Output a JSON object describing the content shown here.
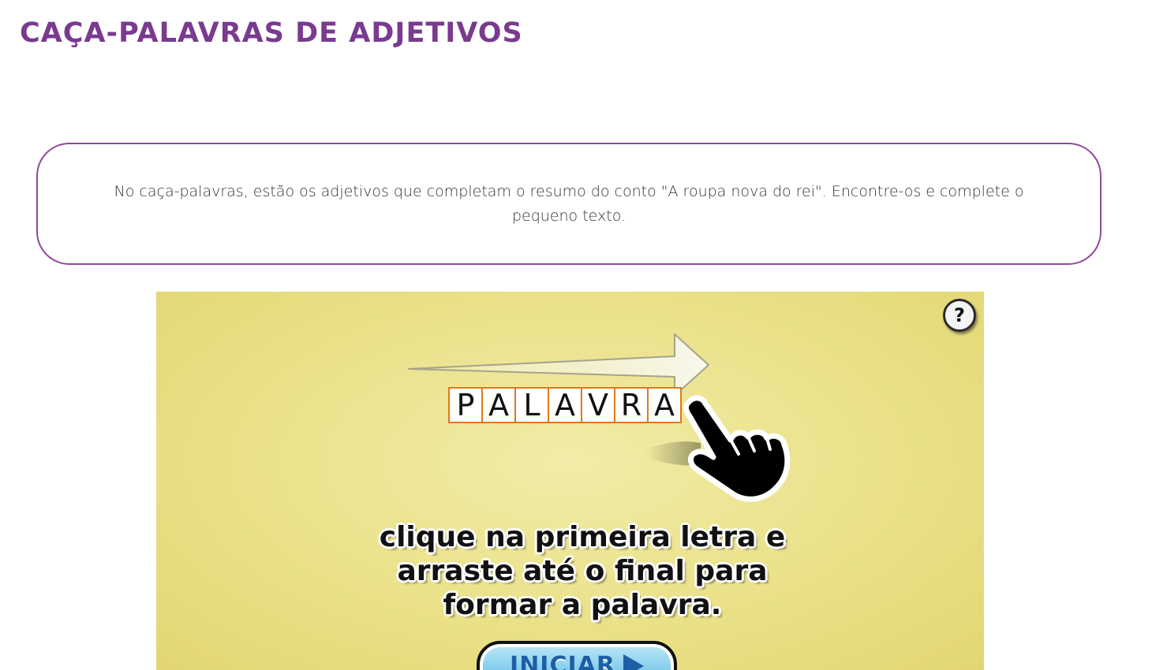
{
  "page": {
    "title": "CAÇA-PALAVRAS DE ADJETIVOS",
    "instructions": "No caça-palavras, estão os adjetivos que completam o resumo do conto \"A roupa nova do rei\". Encontre-os e complete o pequeno texto."
  },
  "game": {
    "help_label": "?",
    "example_word_letters": [
      "P",
      "A",
      "L",
      "A",
      "V",
      "R",
      "A"
    ],
    "caption": "clique na primeira letra e arraste até o final para formar a palavra.",
    "start_label": "INICIAR",
    "colors": {
      "background": "#ebe38e",
      "letter_border": "#e07a1a",
      "title": "#7a3a8f",
      "start_button": "#4fb6e3"
    },
    "icons": [
      "question-mark-icon",
      "arrow-right-icon",
      "pointing-hand-icon",
      "play-icon"
    ]
  }
}
